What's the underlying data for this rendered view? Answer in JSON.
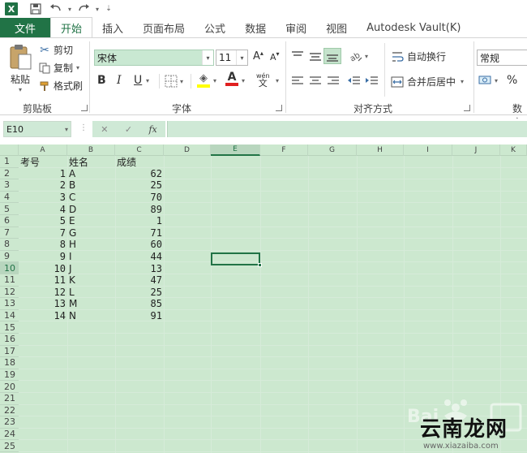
{
  "titlebar": {
    "app_logo": "X",
    "qat_icons": [
      "save-icon",
      "undo-icon",
      "redo-icon",
      "customize-icon"
    ]
  },
  "tabs": [
    {
      "label": "文件",
      "kind": "file"
    },
    {
      "label": "开始",
      "kind": "active"
    },
    {
      "label": "插入",
      "kind": "normal"
    },
    {
      "label": "页面布局",
      "kind": "normal"
    },
    {
      "label": "公式",
      "kind": "normal"
    },
    {
      "label": "数据",
      "kind": "normal"
    },
    {
      "label": "审阅",
      "kind": "normal"
    },
    {
      "label": "视图",
      "kind": "normal"
    },
    {
      "label": "Autodesk Vault(K)",
      "kind": "normal"
    }
  ],
  "ribbon": {
    "clipboard": {
      "paste": "粘贴",
      "cut": "剪切",
      "copy": "复制",
      "format_painter": "格式刷",
      "label": "剪贴板"
    },
    "font": {
      "name": "宋体",
      "size": "11",
      "bold": "B",
      "italic": "I",
      "underline": "U",
      "grow": "A",
      "shrink": "A",
      "font_color": "A",
      "phonetic": "wén",
      "label": "字体"
    },
    "alignment": {
      "wrap_text": "自动换行",
      "merge_center": "合并后居中",
      "label": "对齐方式"
    },
    "number": {
      "format": "常规",
      "percent": "%",
      "label": "数字"
    }
  },
  "formula_bar": {
    "name_box": "E10",
    "cancel": "✕",
    "enter": "✓",
    "fx": "fx",
    "formula": ""
  },
  "sheet": {
    "columns": [
      "A",
      "B",
      "C",
      "D",
      "E",
      "F",
      "G",
      "H",
      "I",
      "J",
      "K"
    ],
    "selected_column": "E",
    "rows": [
      "1",
      "2",
      "3",
      "4",
      "5",
      "6",
      "7",
      "8",
      "9",
      "10",
      "11",
      "12",
      "13",
      "14",
      "15",
      "16",
      "17",
      "18",
      "19",
      "20",
      "21",
      "22",
      "23",
      "24",
      "25"
    ],
    "selected_row": "10",
    "header": [
      "考号",
      "姓名",
      "成绩"
    ],
    "data": [
      [
        "1",
        "A",
        "62"
      ],
      [
        "2",
        "B",
        "25"
      ],
      [
        "3",
        "C",
        "70"
      ],
      [
        "4",
        "D",
        "89"
      ],
      [
        "5",
        "E",
        "1"
      ],
      [
        "7",
        "G",
        "71"
      ],
      [
        "8",
        "H",
        "60"
      ],
      [
        "9",
        "I",
        "44"
      ],
      [
        "10",
        "J",
        "13"
      ],
      [
        "11",
        "K",
        "47"
      ],
      [
        "12",
        "L",
        "25"
      ],
      [
        "13",
        "M",
        "85"
      ],
      [
        "14",
        "N",
        "91"
      ]
    ]
  },
  "watermark": {
    "brand": "云南龙网",
    "url": "www.xiazaiba.com"
  },
  "colors": {
    "excel_green": "#217346",
    "grid_bg": "#cce8cf"
  }
}
